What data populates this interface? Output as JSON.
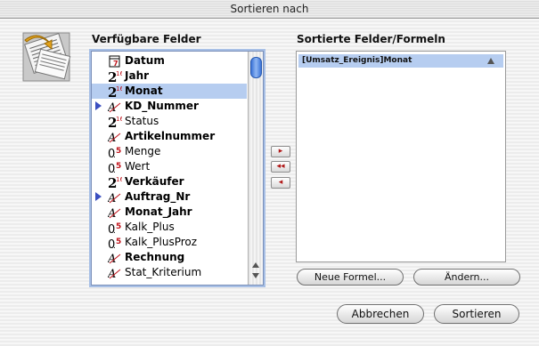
{
  "window": {
    "title": "Sortieren nach"
  },
  "available": {
    "heading": "Verfügbare Felder",
    "items": [
      {
        "label": "Datum",
        "bold": true,
        "type": "date",
        "expand": false,
        "selected": false
      },
      {
        "label": "Jahr",
        "bold": true,
        "type": "integer",
        "expand": false,
        "selected": false
      },
      {
        "label": "Monat",
        "bold": true,
        "type": "integer",
        "expand": false,
        "selected": true
      },
      {
        "label": "KD_Nummer",
        "bold": true,
        "type": "alpha",
        "expand": true,
        "selected": false
      },
      {
        "label": "Status",
        "bold": false,
        "type": "integer",
        "expand": false,
        "selected": false
      },
      {
        "label": "Artikelnummer",
        "bold": true,
        "type": "alpha",
        "expand": false,
        "selected": false
      },
      {
        "label": "Menge",
        "bold": false,
        "type": "real",
        "expand": false,
        "selected": false
      },
      {
        "label": "Wert",
        "bold": false,
        "type": "real",
        "expand": false,
        "selected": false
      },
      {
        "label": "Verkäufer",
        "bold": true,
        "type": "integer",
        "expand": false,
        "selected": false
      },
      {
        "label": "Auftrag_Nr",
        "bold": true,
        "type": "alpha",
        "expand": true,
        "selected": false
      },
      {
        "label": "Monat_Jahr",
        "bold": true,
        "type": "alpha",
        "expand": false,
        "selected": false
      },
      {
        "label": "Kalk_Plus",
        "bold": false,
        "type": "real",
        "expand": false,
        "selected": false
      },
      {
        "label": "Kalk_PlusProz",
        "bold": false,
        "type": "real",
        "expand": false,
        "selected": false
      },
      {
        "label": "Rechnung",
        "bold": true,
        "type": "alpha",
        "expand": false,
        "selected": false
      },
      {
        "label": "Stat_Kriterium",
        "bold": false,
        "type": "alpha",
        "expand": false,
        "selected": false
      }
    ]
  },
  "transfer": {
    "add": "▸",
    "remove_all": "◂◂",
    "remove": "◂"
  },
  "sorted": {
    "heading": "Sortierte Felder/Formeln",
    "items": [
      {
        "label": "[Umsatz_Ereignis]Monat"
      }
    ]
  },
  "buttons": {
    "new_formula": "Neue Formel...",
    "edit": "Ändern...",
    "cancel": "Abbrechen",
    "sort": "Sortieren"
  },
  "colors": {
    "selection": "#b6cdf0",
    "accent": "#3b73d8",
    "type_digit": "#c0141c"
  }
}
